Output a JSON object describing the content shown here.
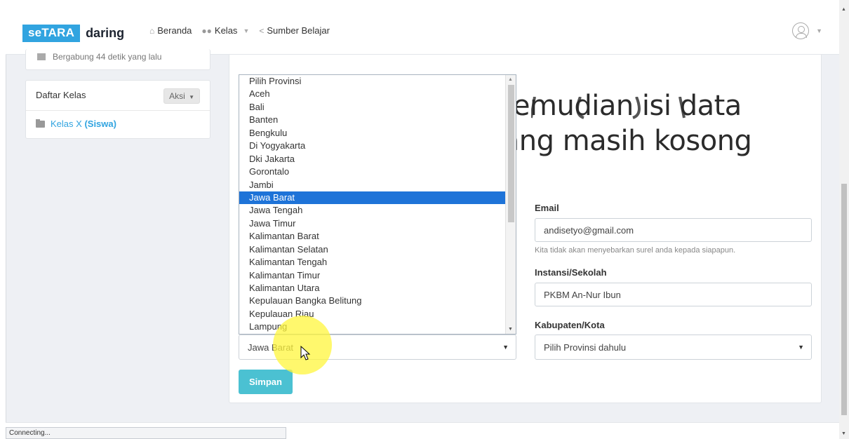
{
  "navbar": {
    "brand_box": "seTARA",
    "brand_text": "daring",
    "items": [
      {
        "icon": "home-icon",
        "label": "Beranda"
      },
      {
        "icon": "users-icon",
        "label": "Kelas"
      },
      {
        "icon": "share-icon",
        "label": "Sumber Belajar"
      }
    ]
  },
  "sidebar": {
    "joined": "Bergabung 44 detik yang lalu",
    "daftar_kelas": "Daftar Kelas",
    "aksi": "Aksi",
    "class_item": "Kelas X",
    "class_role": "(Siswa)"
  },
  "overlay": {
    "line1": "Kemudian isi data",
    "line2": "yang masih kosong"
  },
  "form": {
    "email_label": "Email",
    "email_value": "andisetyo@gmail.com",
    "email_help": "Kita tidak akan menyebarkan surel anda kepada siapapun.",
    "instansi_label": "Instansi/Sekolah",
    "instansi_value": "PKBM An-Nur Ibun",
    "kab_label": "Kabupaten/Kota",
    "kab_value": "Pilih Provinsi dahulu",
    "provinsi_value": "Jawa Barat",
    "save_label": "Simpan"
  },
  "province_options": [
    "Pilih Provinsi",
    "Aceh",
    "Bali",
    "Banten",
    "Bengkulu",
    "Di Yogyakarta",
    "Dki Jakarta",
    "Gorontalo",
    "Jambi",
    "Jawa Barat",
    "Jawa Tengah",
    "Jawa Timur",
    "Kalimantan Barat",
    "Kalimantan Selatan",
    "Kalimantan Tengah",
    "Kalimantan Timur",
    "Kalimantan Utara",
    "Kepulauan Bangka Belitung",
    "Kepulauan Riau",
    "Lampung"
  ],
  "selected_province": "Jawa Barat",
  "status_bar": "Connecting...",
  "colors": {
    "brand": "#31a4e0",
    "selection": "#1e73d8",
    "save_button": "#4bc1d2",
    "highlight": "#fff53c"
  }
}
